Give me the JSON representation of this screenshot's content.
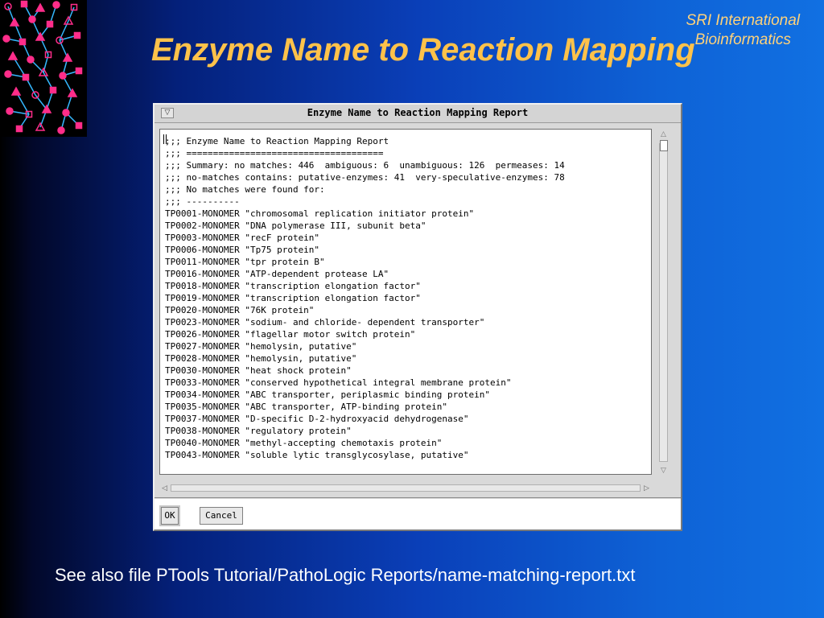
{
  "slide": {
    "organization_lines": [
      "SRI International",
      "Bioinformatics"
    ],
    "title": "Enzyme Name to Reaction Mapping",
    "footer": "See also file PTools Tutorial/PathoLogic Reports/name-matching-report.txt"
  },
  "dialog": {
    "title": "Enzyme Name to Reaction Mapping Report",
    "menu_icon": "window-menu-icon",
    "report_lines": [
      ";;; Enzyme Name to Reaction Mapping Report",
      ";;; =====================================",
      ";;; Summary: no matches: 446  ambiguous: 6  unambiguous: 126  permeases: 14",
      ";;; no-matches contains: putative-enzymes: 41  very-speculative-enzymes: 78",
      ";;; No matches were found for:",
      ";;; ----------",
      "TP0001-MONOMER \"chromosomal replication initiator protein\"",
      "TP0002-MONOMER \"DNA polymerase III, subunit beta\"",
      "TP0003-MONOMER \"recF protein\"",
      "TP0006-MONOMER \"Tp75 protein\"",
      "TP0011-MONOMER \"tpr protein B\"",
      "TP0016-MONOMER \"ATP-dependent protease LA\"",
      "TP0018-MONOMER \"transcription elongation factor\"",
      "TP0019-MONOMER \"transcription elongation factor\"",
      "TP0020-MONOMER \"76K protein\"",
      "TP0023-MONOMER \"sodium- and chloride- dependent transporter\"",
      "TP0026-MONOMER \"flagellar motor switch protein\"",
      "TP0027-MONOMER \"hemolysin, putative\"",
      "TP0028-MONOMER \"hemolysin, putative\"",
      "TP0030-MONOMER \"heat shock protein\"",
      "TP0033-MONOMER \"conserved hypothetical integral membrane protein\"",
      "TP0034-MONOMER \"ABC transporter, periplasmic binding protein\"",
      "TP0035-MONOMER \"ABC transporter, ATP-binding protein\"",
      "TP0037-MONOMER \"D-specific D-2-hydroxyacid dehydrogenase\"",
      "TP0038-MONOMER \"regulatory protein\"",
      "TP0040-MONOMER \"methyl-accepting chemotaxis protein\"",
      "TP0043-MONOMER \"soluble lytic transglycosylase, putative\""
    ],
    "buttons": {
      "ok": "OK",
      "cancel": "Cancel"
    }
  },
  "colors": {
    "title": "#ffc24a",
    "organization": "#ffd27a",
    "footer": "#ffffff",
    "logo_nodes": "#ff2d8a",
    "logo_edges": "#35b8ff"
  }
}
